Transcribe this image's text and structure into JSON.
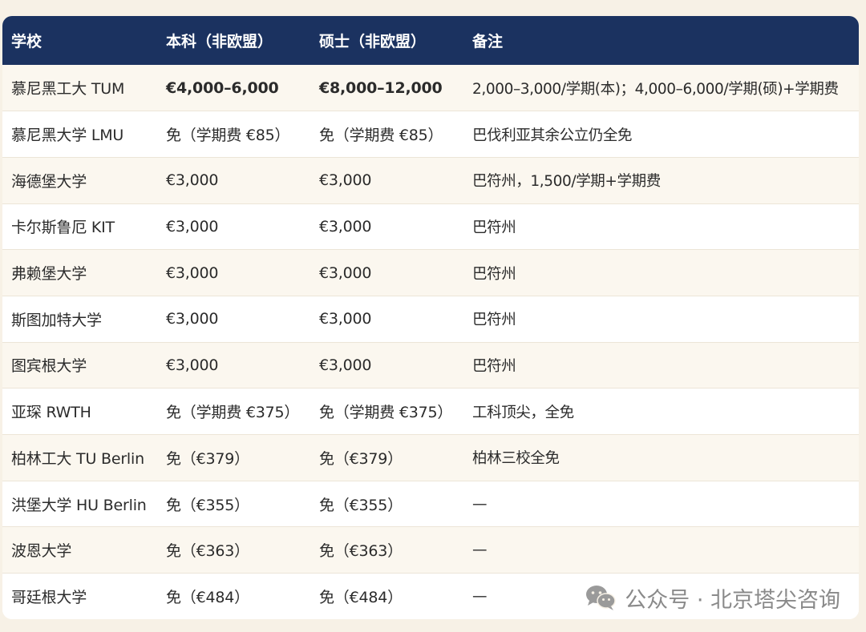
{
  "table": {
    "headers": [
      "学校",
      "本科（非欧盟）",
      "硕士（非欧盟）",
      "备注"
    ],
    "rows": [
      [
        "慕尼黑工大 TUM",
        "€4,000–6,000",
        "€8,000–12,000",
        "2,000–3,000/学期(本)；4,000–6,000/学期(硕)+学期费"
      ],
      [
        "慕尼黑大学 LMU",
        "免（学期费 €85）",
        "免（学期费 €85）",
        "巴伐利亚其余公立仍全免"
      ],
      [
        "海德堡大学",
        "€3,000",
        "€3,000",
        "巴符州，1,500/学期+学期费"
      ],
      [
        "卡尔斯鲁厄 KIT",
        "€3,000",
        "€3,000",
        "巴符州"
      ],
      [
        "弗赖堡大学",
        "€3,000",
        "€3,000",
        "巴符州"
      ],
      [
        "斯图加特大学",
        "€3,000",
        "€3,000",
        "巴符州"
      ],
      [
        "图宾根大学",
        "€3,000",
        "€3,000",
        "巴符州"
      ],
      [
        "亚琛 RWTH",
        "免（学期费 €375）",
        "免（学期费 €375）",
        "工科顶尖，全免"
      ],
      [
        "柏林工大 TU Berlin",
        "免（€379）",
        "免（€379）",
        "柏林三校全免"
      ],
      [
        "洪堡大学 HU Berlin",
        "免（€355）",
        "免（€355）",
        "—"
      ],
      [
        "波恩大学",
        "免（€363）",
        "免（€363）",
        "—"
      ],
      [
        "哥廷根大学",
        "免（€484）",
        "免（€484）",
        "—"
      ]
    ]
  },
  "watermark": {
    "text": "公众号 · 北京塔尖咨询",
    "icon": "wechat-icon"
  },
  "colors": {
    "header_bg": "#1b3260",
    "page_bg": "#f7f1e6",
    "row_alt_bg": "#fbf7ef"
  }
}
